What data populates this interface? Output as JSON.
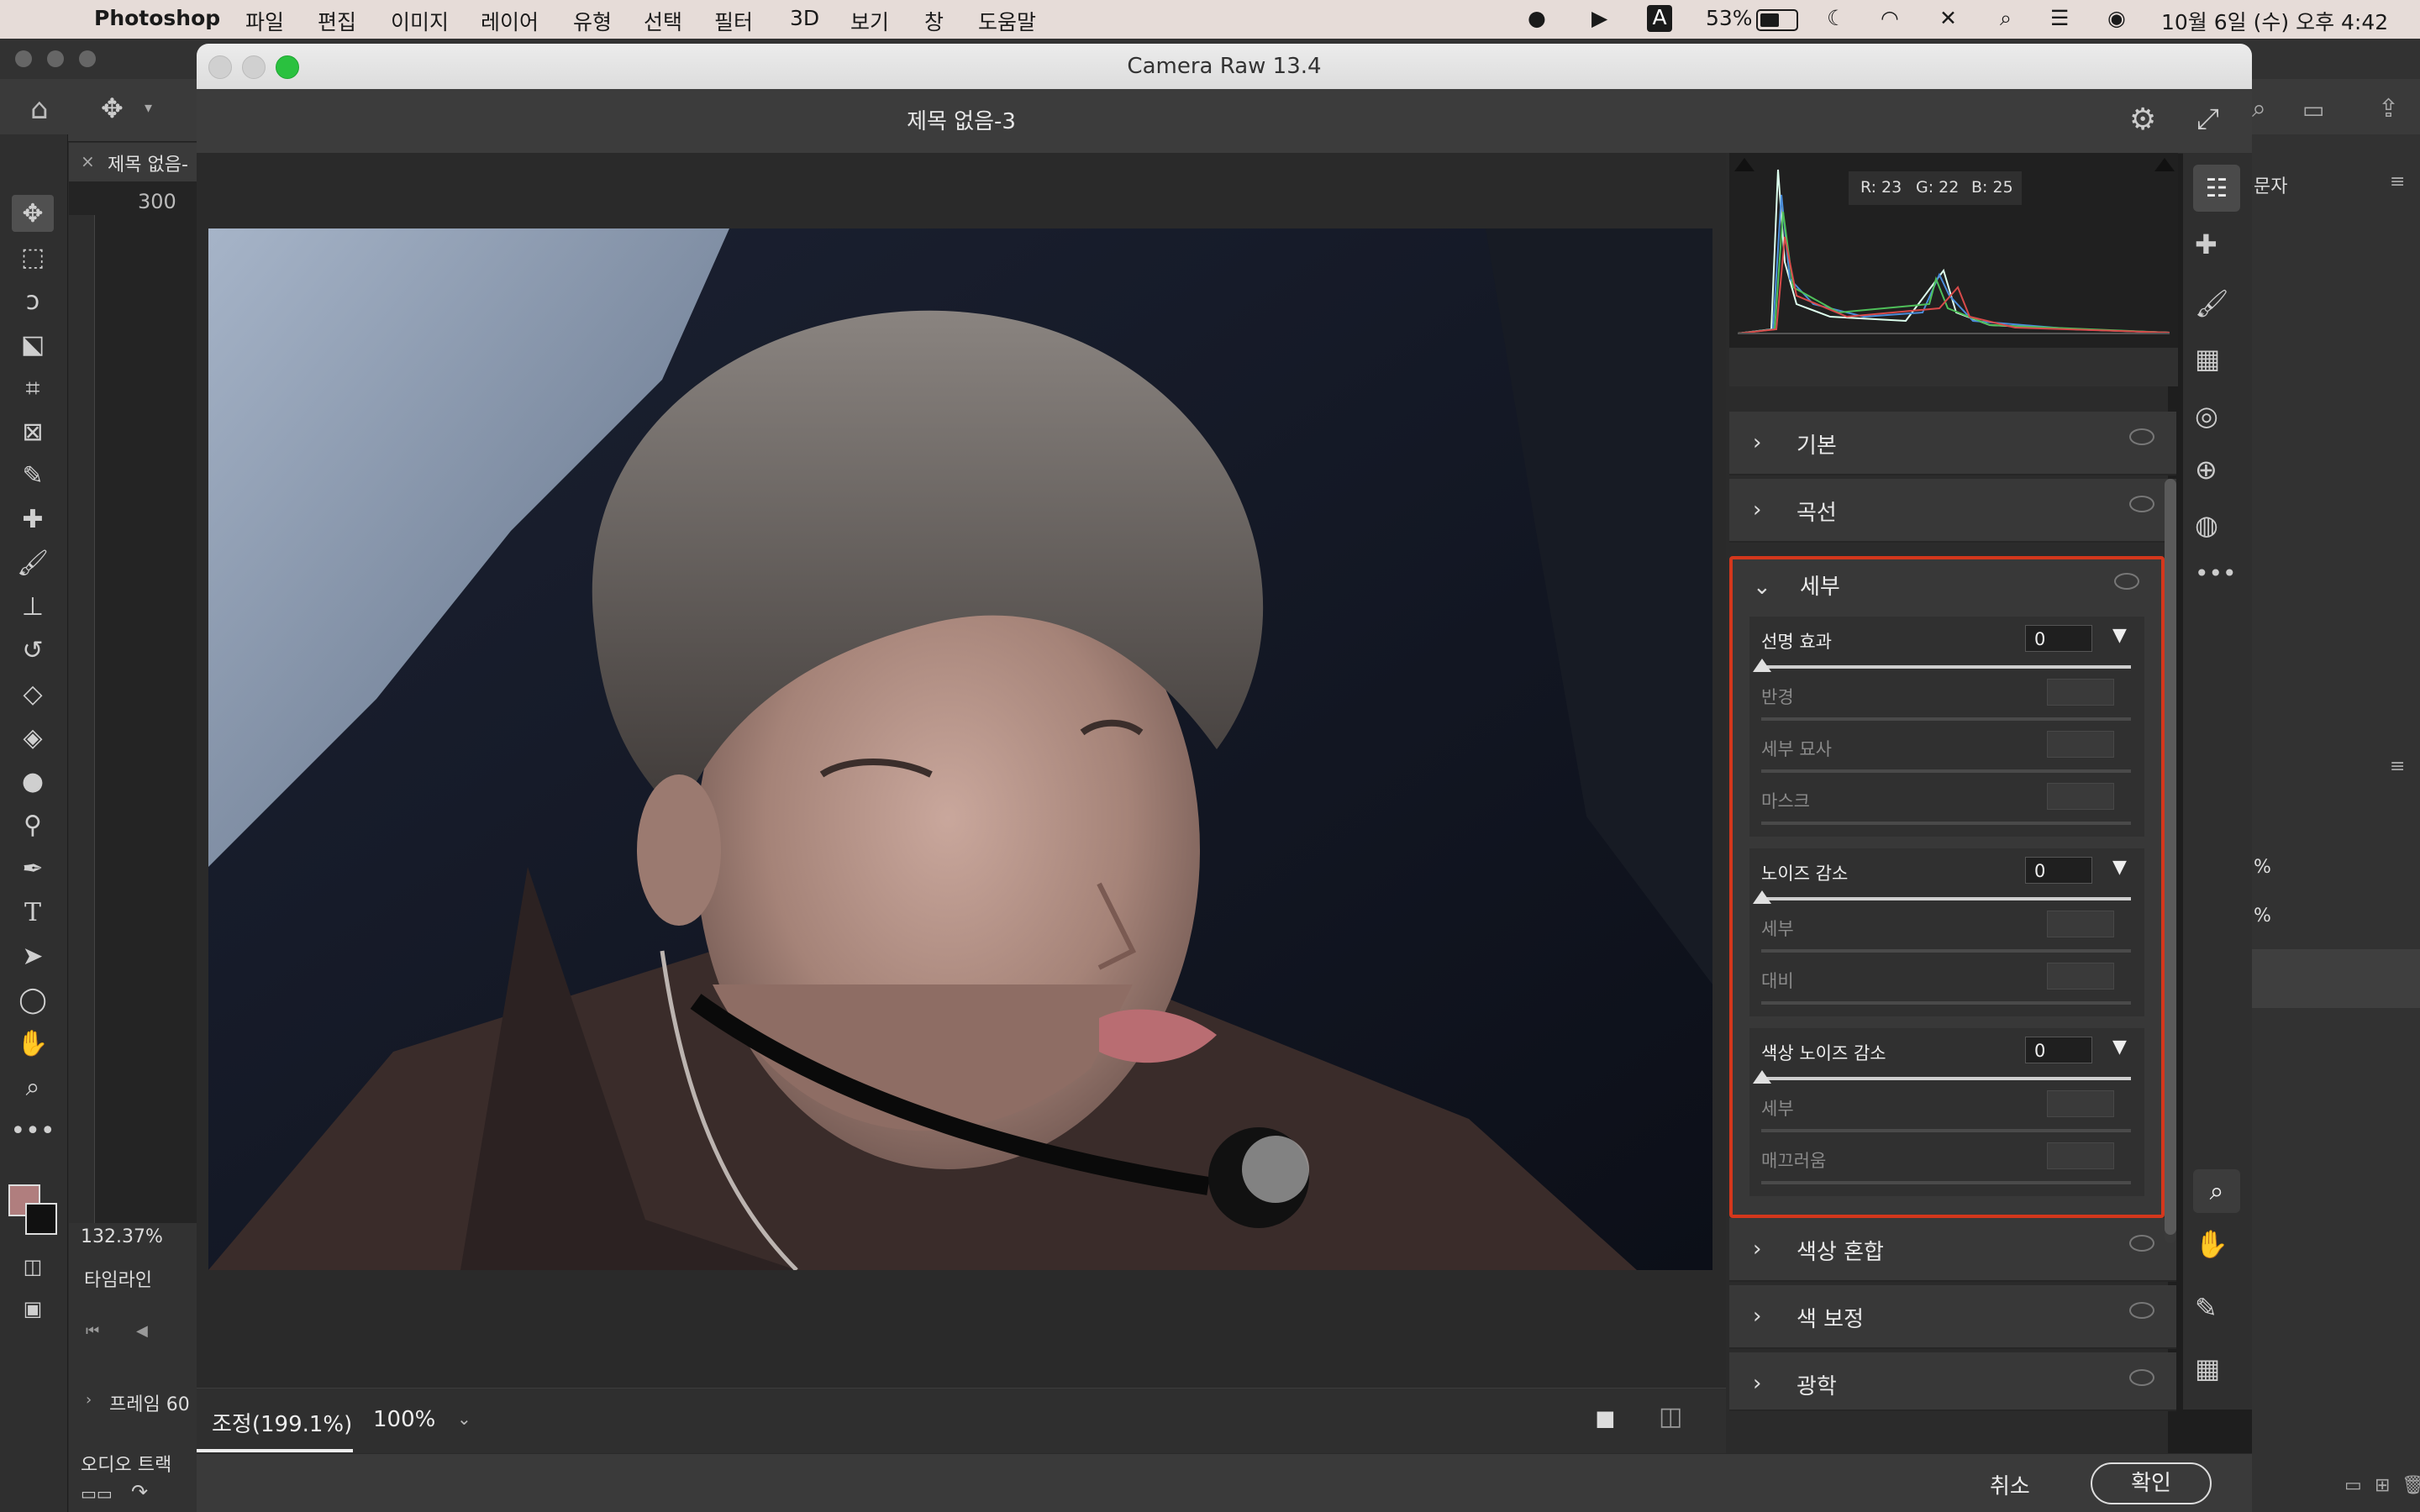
{
  "menubar": {
    "app_name": "Photoshop",
    "menus": [
      "파일",
      "편집",
      "이미지",
      "레이어",
      "유형",
      "선택",
      "필터",
      "3D",
      "보기",
      "창",
      "도움말"
    ],
    "battery": "53%",
    "ime_badge": "A",
    "datetime": "10월 6일 (수) 오후 4:42"
  },
  "photoshop": {
    "tab_title": "제목 없음-",
    "ruler_value": "300",
    "zoom": "132.37%",
    "timeline_label": "타임라인",
    "frame_label": "프레임 60",
    "audio_track_label": "오디오 트랙",
    "right_panel_tab": "문자",
    "percent_1": "%",
    "percent_2": "%"
  },
  "camera_raw": {
    "window_title": "Camera Raw 13.4",
    "document_title": "제목 없음-3",
    "histogram_readout": {
      "r": "R: 23",
      "g": "G: 22",
      "b": "B: 25"
    },
    "sections": {
      "basic": "기본",
      "curve": "곡선",
      "detail": "세부",
      "color_mixer": "색상 혼합",
      "color_grading": "색 보정",
      "optics": "광학"
    },
    "detail": {
      "sharpening": {
        "label": "선명 효과",
        "value": "0",
        "radius": "반경",
        "detail": "세부 묘사",
        "masking": "마스크"
      },
      "noise_reduction": {
        "label": "노이즈 감소",
        "value": "0",
        "detail": "세부",
        "contrast": "대비"
      },
      "color_noise_reduction": {
        "label": "색상 노이즈 감소",
        "value": "0",
        "detail": "세부",
        "smoothness": "매끄러움"
      }
    },
    "bottom": {
      "fit_label": "조정(199.1%)",
      "zoom_label": "100%"
    },
    "footer": {
      "cancel": "취소",
      "ok": "확인"
    }
  },
  "colors": {
    "accent_red": "#d4371c",
    "panel_bg": "#383838",
    "menubar_bg": "#e6dcd8"
  }
}
